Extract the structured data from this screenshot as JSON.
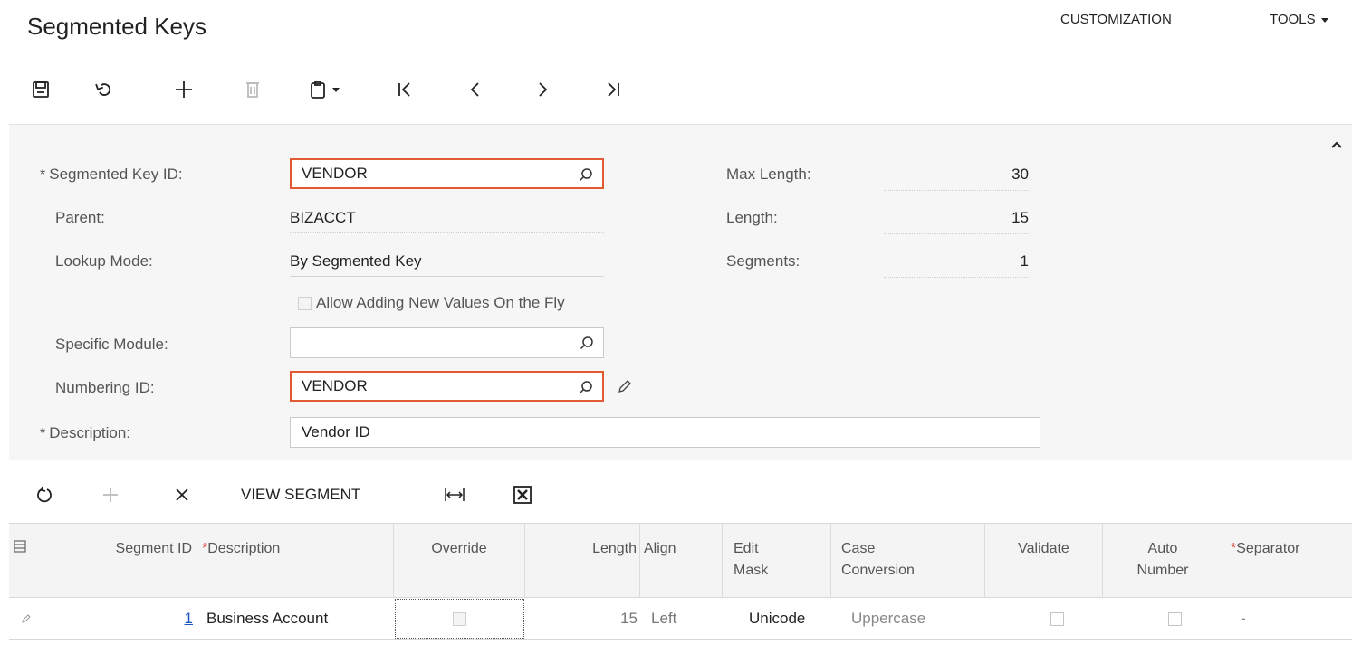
{
  "header": {
    "title": "Segmented Keys",
    "customization": "CUSTOMIZATION",
    "tools": "TOOLS"
  },
  "toolbar": {
    "icons": [
      "save-icon",
      "undo-icon",
      "add-icon",
      "delete-icon",
      "clipboard-icon",
      "first-icon",
      "prev-icon",
      "next-icon",
      "last-icon"
    ]
  },
  "form": {
    "segmented_key_id": {
      "label": "Segmented Key ID:",
      "value": "VENDOR"
    },
    "parent": {
      "label": "Parent:",
      "value": "BIZACCT"
    },
    "lookup_mode": {
      "label": "Lookup Mode:",
      "value": "By Segmented Key"
    },
    "allow_adding": {
      "label": "Allow Adding New Values On the Fly",
      "checked": false
    },
    "specific_module": {
      "label": "Specific Module:",
      "value": ""
    },
    "numbering_id": {
      "label": "Numbering ID:",
      "value": "VENDOR"
    },
    "description": {
      "label": "Description:",
      "value": "Vendor ID"
    },
    "max_length": {
      "label": "Max Length:",
      "value": "30"
    },
    "length": {
      "label": "Length:",
      "value": "15"
    },
    "segments": {
      "label": "Segments:",
      "value": "1"
    },
    "required_mark": "*"
  },
  "grid_toolbar": {
    "view_segment": "VIEW SEGMENT"
  },
  "grid": {
    "columns": {
      "segment_id": "Segment ID",
      "description": "Description",
      "override": "Override",
      "length": "Length",
      "align": "Align",
      "edit_mask_1": "Edit",
      "edit_mask_2": "Mask",
      "case_conv_1": "Case",
      "case_conv_2": "Conversion",
      "validate": "Validate",
      "auto_number_1": "Auto",
      "auto_number_2": "Number",
      "separator": "Separator",
      "required_mark": "*"
    },
    "row": {
      "segment_id": "1",
      "description": "Business Account",
      "override": false,
      "length": "15",
      "align": "Left",
      "edit_mask": "Unicode",
      "case_conversion": "Uppercase",
      "validate": false,
      "auto_number": false,
      "separator": "-"
    }
  },
  "colors": {
    "highlight": "#e15a33",
    "link": "#1a55c4",
    "required": "#e03c31"
  }
}
